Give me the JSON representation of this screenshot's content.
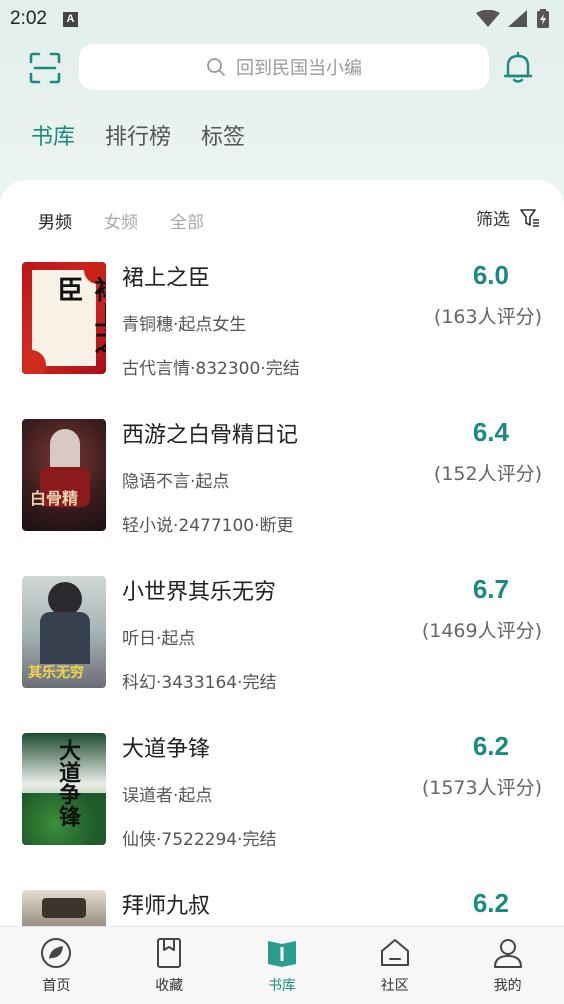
{
  "status_bar": {
    "time": "2:02",
    "notification_icon": "A"
  },
  "header": {
    "search_placeholder": "回到民国当小编",
    "scan_icon": "scan-icon",
    "bell_icon": "bell-icon"
  },
  "top_tabs": [
    {
      "label": "书库",
      "active": true
    },
    {
      "label": "排行榜",
      "active": false
    },
    {
      "label": "标签",
      "active": false
    }
  ],
  "sub_tabs": [
    {
      "label": "男频",
      "active": true
    },
    {
      "label": "女频",
      "active": false
    },
    {
      "label": "全部",
      "active": false
    }
  ],
  "filter_label": "筛选",
  "books": [
    {
      "title": "裙上之臣",
      "author": "青铜穗·起点女生",
      "meta": "古代言情·832300·完结",
      "score": "6.0",
      "count": "(163人评分)"
    },
    {
      "title": "西游之白骨精日记",
      "author": "隐语不言·起点",
      "meta": "轻小说·2477100·断更",
      "score": "6.4",
      "count": "(152人评分)"
    },
    {
      "title": "小世界其乐无穷",
      "author": "听日·起点",
      "meta": "科幻·3433164·完结",
      "score": "6.7",
      "count": "(1469人评分)"
    },
    {
      "title": "大道争锋",
      "author": "误道者·起点",
      "meta": "仙侠·7522294·完结",
      "score": "6.2",
      "count": "(1573人评分)"
    },
    {
      "title": "拜师九叔",
      "author": "",
      "meta": "",
      "score": "6.2",
      "count": ""
    }
  ],
  "bottom_nav": [
    {
      "label": "首页",
      "icon": "home-icon",
      "active": false
    },
    {
      "label": "收藏",
      "icon": "bookmark-icon",
      "active": false
    },
    {
      "label": "书库",
      "icon": "library-icon",
      "active": true
    },
    {
      "label": "社区",
      "icon": "community-icon",
      "active": false
    },
    {
      "label": "我的",
      "icon": "profile-icon",
      "active": false
    }
  ],
  "colors": {
    "accent": "#1b8a80",
    "highlight": "#f7df4a"
  }
}
